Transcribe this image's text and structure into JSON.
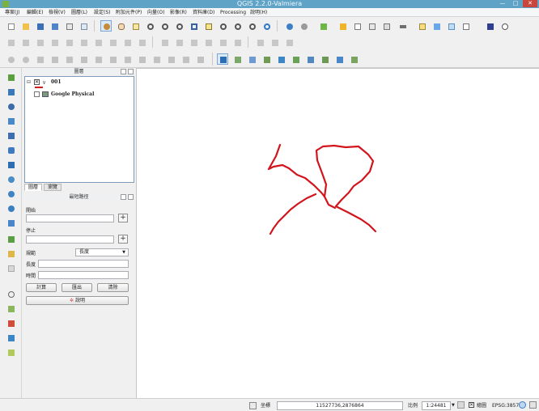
{
  "window": {
    "title": "QGIS 2.2.0-Valmiera",
    "minimize": "—",
    "maximize": "□",
    "close": "✕"
  },
  "menu": [
    "專案(J)",
    "編輯(E)",
    "檢視(V)",
    "圖層(L)",
    "設定(S)",
    "附加元件(P)",
    "向量(O)",
    "影像(R)",
    "資料庫(D)",
    "Processing",
    "說明(H)"
  ],
  "layers_panel": {
    "title": "圖層",
    "layers": [
      {
        "name": "001",
        "checked": true,
        "symbol_color": "#d11f1f"
      },
      {
        "name": "Google Physical",
        "checked": false
      }
    ],
    "tabs": [
      "圖層",
      "瀏覽"
    ]
  },
  "route_panel": {
    "title": "最短路徑",
    "start_label": "開始",
    "start_value": "",
    "stop_label": "停止",
    "stop_value": "",
    "criterion_label": "規範",
    "criterion_value": "長度",
    "length_label": "長度",
    "length_value": "",
    "time_label": "時間",
    "time_value": "",
    "calculate_button": "計算",
    "export_button": "匯出",
    "clear_button": "清除",
    "help_button": "說明",
    "add_button": "+"
  },
  "statusbar": {
    "coordinate_label": "坐標",
    "coordinate_value": "11527736,2876864",
    "scale_label": "比例",
    "scale_value": "1:24481",
    "render_label": "繪圖",
    "crs_value": "EPSG:3857"
  },
  "map": {
    "stroke_color": "#d2141c"
  },
  "icons": {
    "toolbar_file": [
      "new-project-icon",
      "open-project-icon",
      "save-project-icon",
      "save-as-icon",
      "print-composer-icon",
      "composer-manager-icon"
    ],
    "toolbar_nav": [
      "pan-touch-icon",
      "pan-map-icon",
      "pan-to-selection-icon",
      "zoom-in-icon",
      "zoom-out-icon",
      "zoom-actual-icon",
      "zoom-full-icon",
      "zoom-to-selection-icon",
      "zoom-to-layer-icon",
      "zoom-last-icon",
      "zoom-next-icon",
      "refresh-icon"
    ],
    "toolbar_attr": [
      "identify-icon",
      "run-action-icon",
      "select-icon",
      "deselect-icon",
      "open-table-icon",
      "measure-icon",
      "map-tips-icon",
      "text-annotation-icon",
      "new-bookmark-icon",
      "show-bookmarks-icon",
      "help-icon"
    ],
    "vertical": [
      "add-vector-layer-icon",
      "add-raster-layer-icon",
      "add-postgis-layer-icon",
      "add-spatialite-layer-icon",
      "add-mssql-layer-icon",
      "add-oracle-layer-icon",
      "add-wfs-layer-icon",
      "add-wms-layer-icon",
      "add-wcs-layer-icon",
      "add-delimited-text-icon",
      "new-shapefile-icon",
      "new-spatialite-icon",
      "new-gpx-icon",
      "gps-tools-icon",
      "python-console-icon",
      "plugin-icon",
      "coordinate-capture-icon"
    ]
  }
}
